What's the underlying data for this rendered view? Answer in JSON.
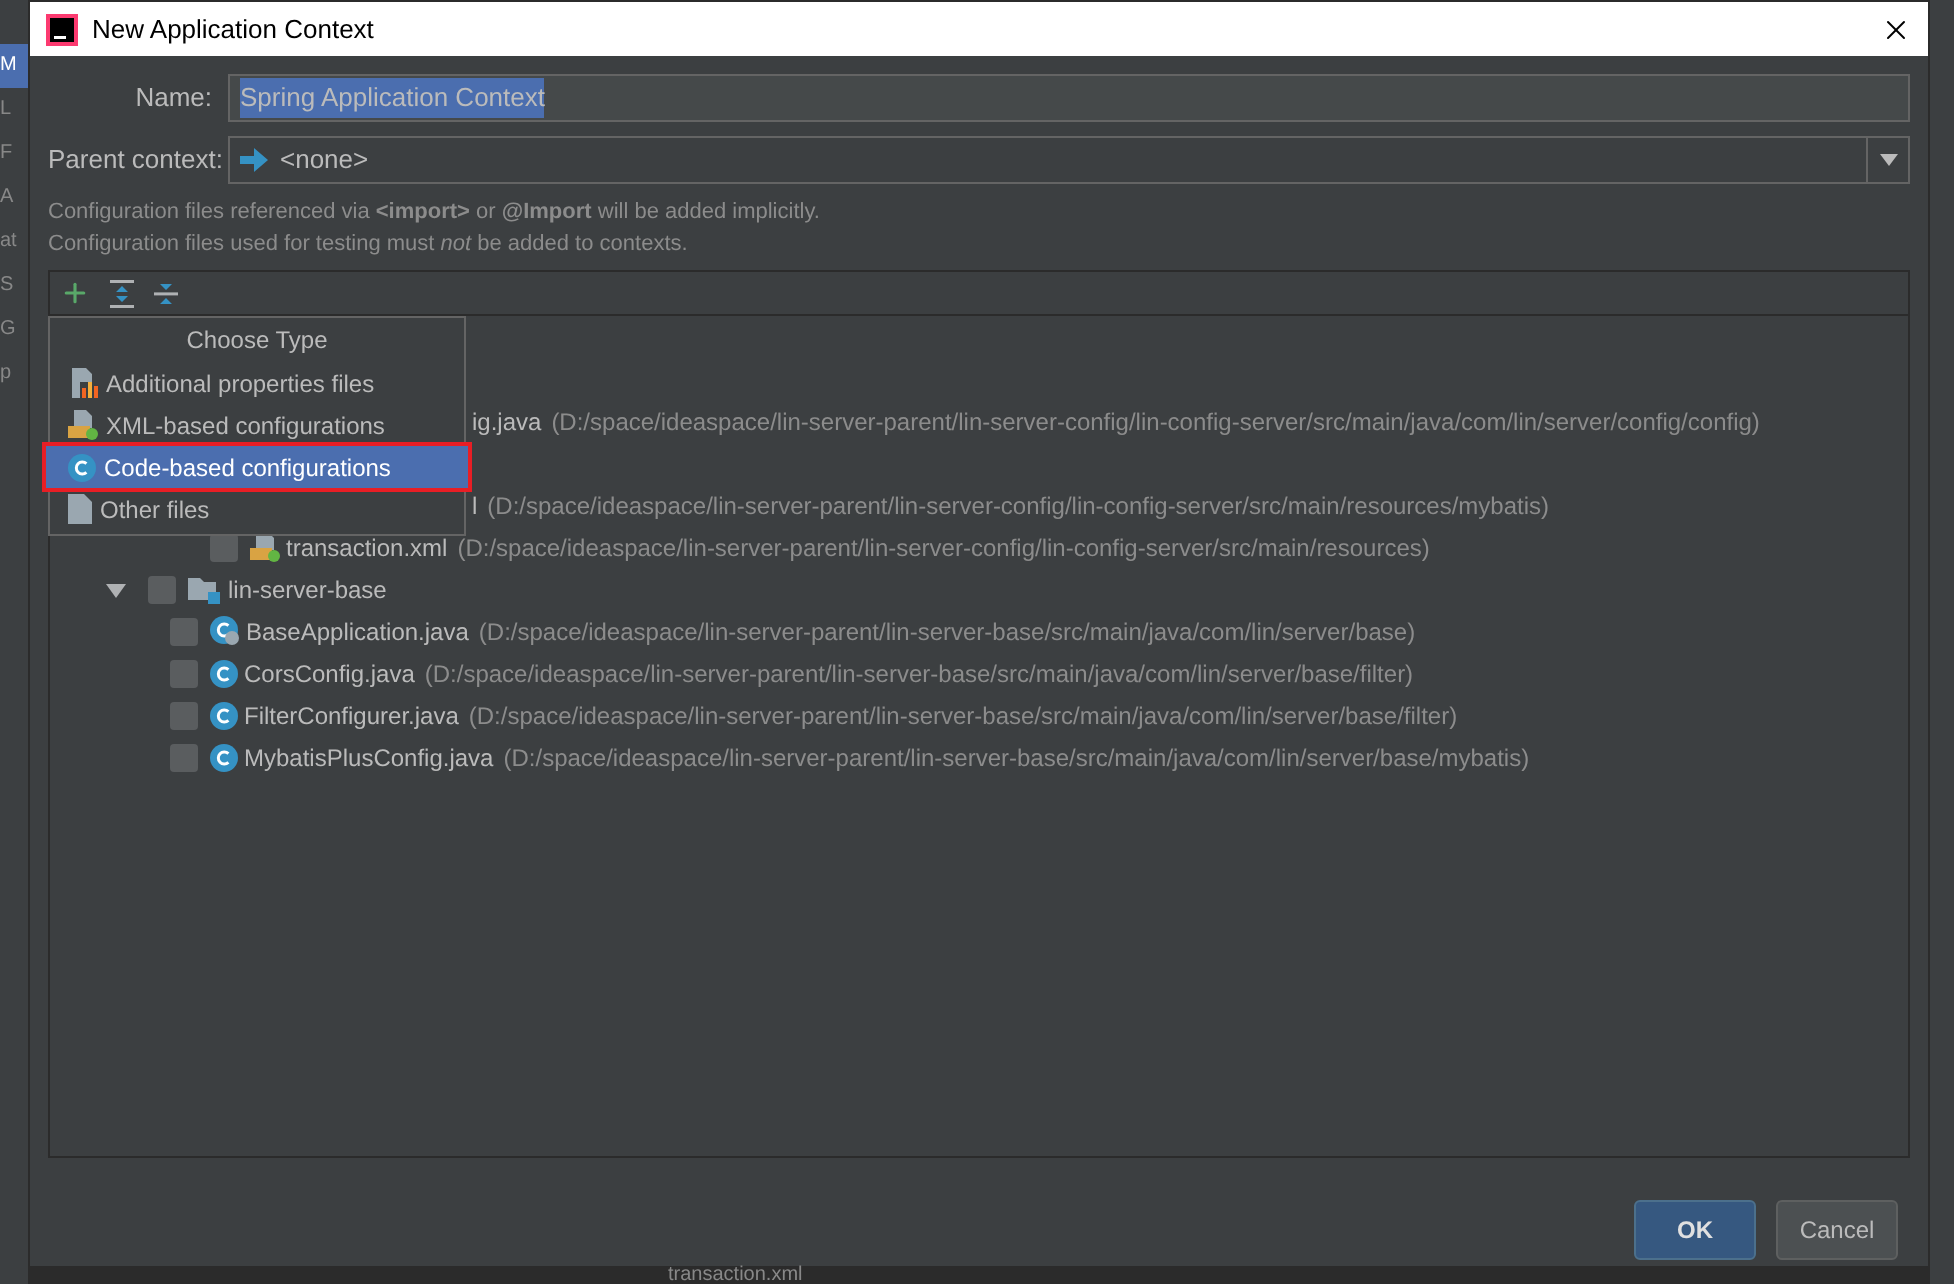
{
  "backdrop": {
    "side_items": [
      {
        "text": "M",
        "selected": true
      },
      {
        "text": "L",
        "selected": false
      },
      {
        "text": "F",
        "selected": false
      },
      {
        "text": "A",
        "selected": false
      },
      {
        "text": "at",
        "selected": false
      },
      {
        "text": "S",
        "selected": false
      },
      {
        "text": "G",
        "selected": false
      },
      {
        "text": "p",
        "selected": false
      }
    ],
    "bottom_text": "transaction.xml"
  },
  "window": {
    "title": "New Application Context"
  },
  "form": {
    "name_label": "Name:",
    "name_value": "Spring Application Context",
    "name_text_selected": true,
    "parent_label": "Parent context:",
    "parent_value": "<none>"
  },
  "hints": [
    "Configuration files referenced via **<import>** or **@Import** will be added implicitly.",
    "Configuration files used for testing must *not* be added to contexts."
  ],
  "tree": [
    {
      "kind": "covered"
    },
    {
      "kind": "partial",
      "name": "ig.java",
      "path": "(D:/space/ideaspace/lin-server-parent/lin-server-config/lin-config-server/src/main/java/com/lin/server/config/config)"
    },
    {
      "kind": "covered"
    },
    {
      "kind": "partial",
      "name": "l",
      "path": "(D:/space/ideaspace/lin-server-parent/lin-server-config/lin-config-server/src/main/resources/mybatis)",
      "children": [
        {
          "kind": "xml",
          "name": "transaction.xml",
          "checked": false,
          "path": "(D:/space/ideaspace/lin-server-parent/lin-server-config/lin-config-server/src/main/resources)"
        }
      ]
    },
    {
      "kind": "module",
      "name": "lin-server-base",
      "checked": false,
      "expanded": true,
      "children": [
        {
          "kind": "app_class",
          "name": "BaseApplication.java",
          "checked": false,
          "path": "(D:/space/ideaspace/lin-server-parent/lin-server-base/src/main/java/com/lin/server/base)"
        },
        {
          "kind": "class",
          "name": "CorsConfig.java",
          "checked": false,
          "path": "(D:/space/ideaspace/lin-server-parent/lin-server-base/src/main/java/com/lin/server/base/filter)"
        },
        {
          "kind": "class",
          "name": "FilterConfigurer.java",
          "checked": false,
          "path": "(D:/space/ideaspace/lin-server-parent/lin-server-base/src/main/java/com/lin/server/base/filter)"
        },
        {
          "kind": "class",
          "name": "MybatisPlusConfig.java",
          "checked": false,
          "path": "(D:/space/ideaspace/lin-server-parent/lin-server-base/src/main/java/com/lin/server/base/mybatis)"
        }
      ]
    }
  ],
  "popup": {
    "title": "Choose Type",
    "items": [
      {
        "kind": "properties",
        "label": "Additional properties files",
        "selected": false
      },
      {
        "kind": "xml",
        "label": "XML-based configurations",
        "selected": false
      },
      {
        "kind": "class",
        "label": "Code-based configurations",
        "selected": true
      },
      {
        "kind": "file",
        "label": "Other files",
        "selected": false
      }
    ]
  },
  "buttons": [
    "OK",
    "Cancel"
  ]
}
